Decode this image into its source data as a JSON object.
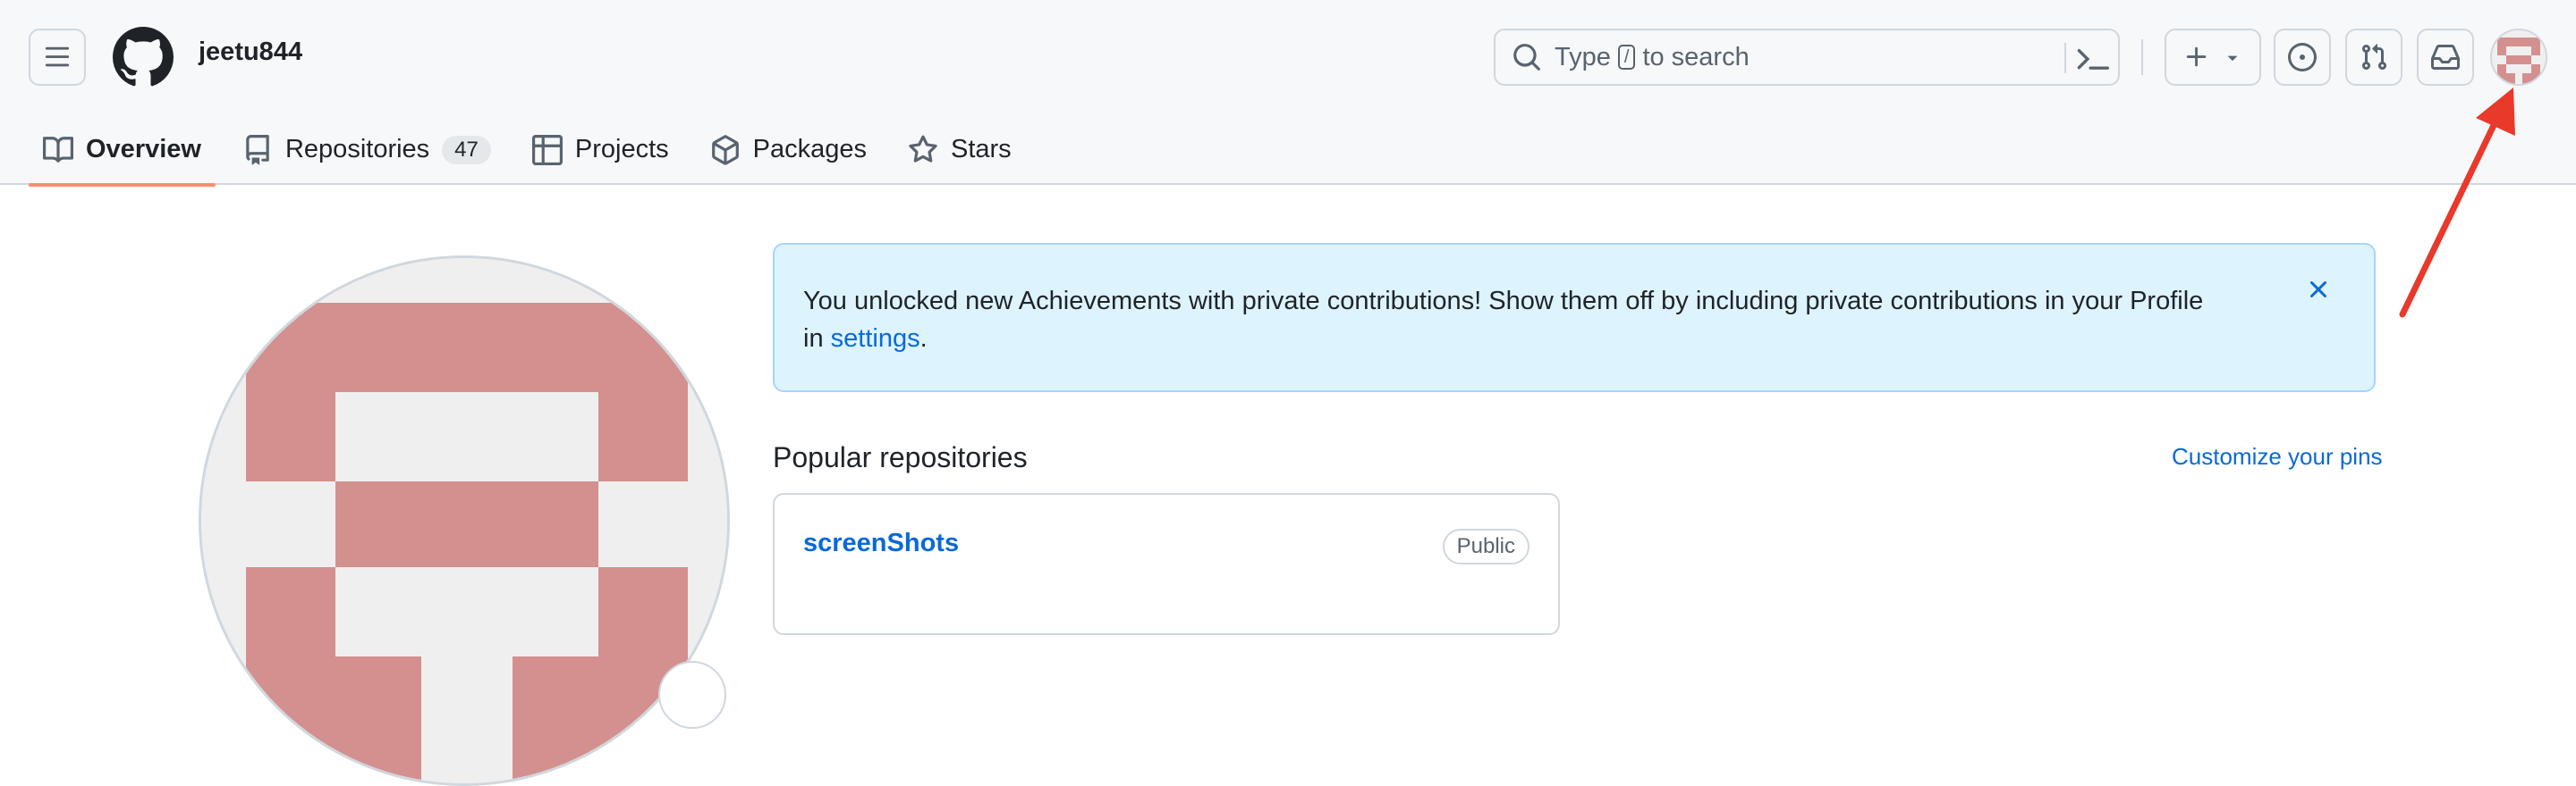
{
  "header": {
    "username": "jeetu844",
    "search": {
      "prefix": "Type",
      "key": "/",
      "suffix": "to search"
    },
    "icons": {
      "menu": "hamburger-icon",
      "logo": "github-mark-icon",
      "search": "search-icon",
      "command": "command-palette-icon",
      "create": "plus-icon",
      "create_caret": "triangle-down-icon",
      "issues": "issue-opened-icon",
      "pulls": "git-pull-request-icon",
      "inbox": "inbox-icon"
    }
  },
  "tabs": [
    {
      "label": "Overview",
      "icon": "book-icon",
      "active": true
    },
    {
      "label": "Repositories",
      "icon": "repo-icon",
      "count": "47"
    },
    {
      "label": "Projects",
      "icon": "table-icon"
    },
    {
      "label": "Packages",
      "icon": "package-icon"
    },
    {
      "label": "Stars",
      "icon": "star-icon"
    }
  ],
  "flash": {
    "text": "You unlocked new Achievements with private contributions! Show them off by including private contributions in your Profile in",
    "link": "settings",
    "end": "."
  },
  "popular": {
    "title": "Popular repositories",
    "customize": "Customize your pins",
    "repos": [
      {
        "name": "screenShots",
        "visibility": "Public"
      }
    ]
  },
  "colors": {
    "accent_underline": "#fd8c73",
    "link": "#0969da",
    "flash_bg": "#ddf4ff",
    "avatar_pink": "#d3908e",
    "annotation_arrow": "#e8392b"
  }
}
